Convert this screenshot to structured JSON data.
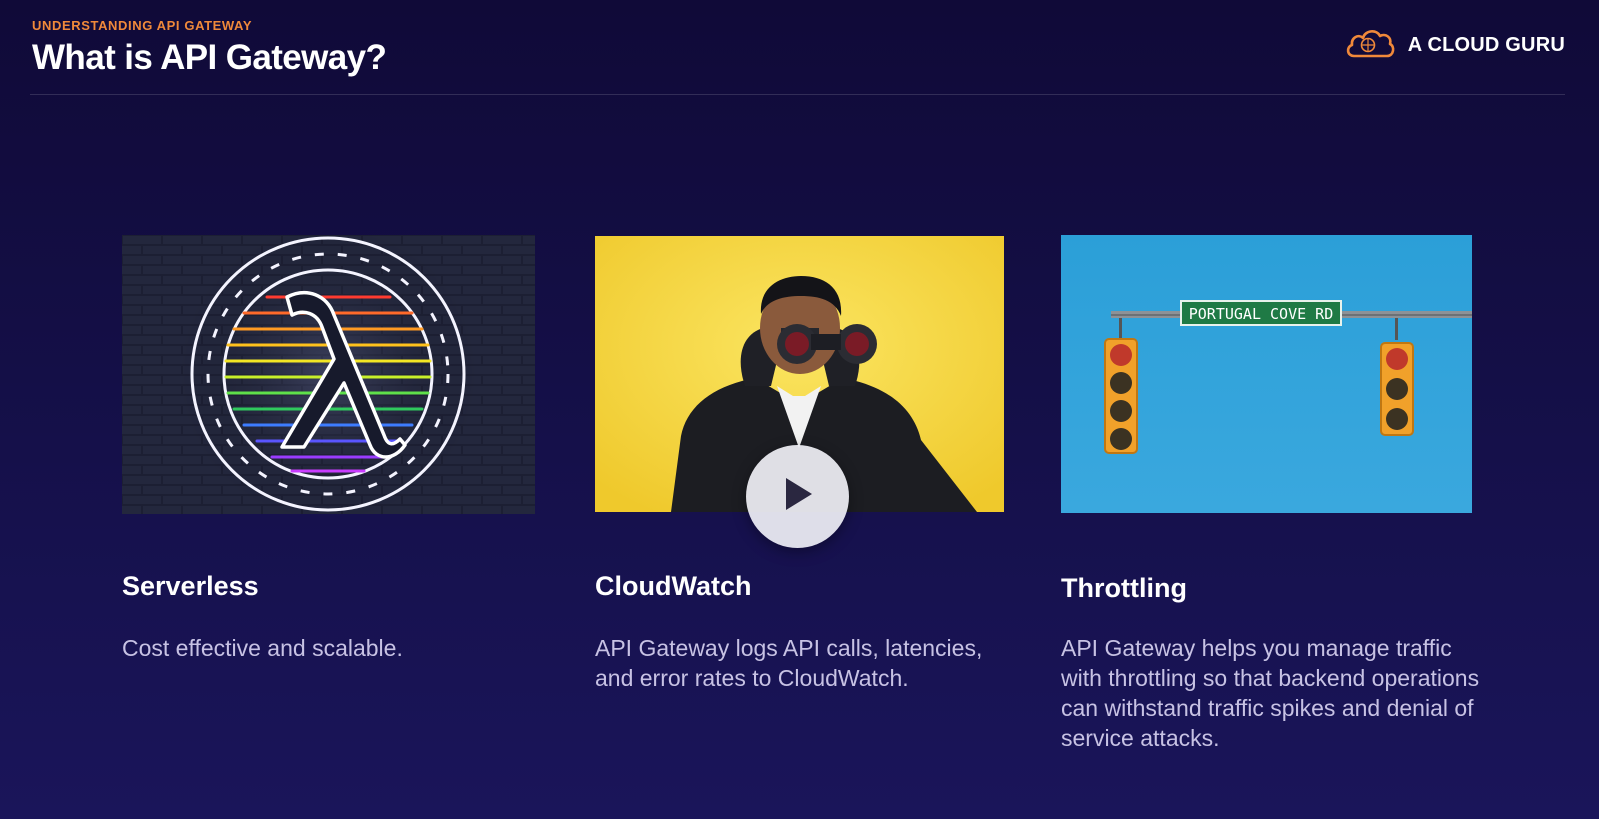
{
  "header": {
    "eyebrow": "UNDERSTANDING API GATEWAY",
    "title": "What is API Gateway?",
    "brand": "A CLOUD GURU"
  },
  "cards": [
    {
      "title": "Serverless",
      "description": "Cost effective and scalable.",
      "image": "neon-lambda-sign"
    },
    {
      "title": "CloudWatch",
      "description": "API Gateway logs API calls, latencies, and error rates to CloudWatch.",
      "image": "man-with-binoculars"
    },
    {
      "title": "Throttling",
      "description": "API Gateway helps you manage traffic with throttling so that backend operations can withstand traffic spikes and denial of service attacks.",
      "image": "traffic-lights",
      "sign_text": "PORTUGAL COVE RD"
    }
  ],
  "video": {
    "play_icon": "play-icon"
  },
  "colors": {
    "accent": "#f0893a",
    "background": "#13104a",
    "body_text": "#c7c2e4"
  }
}
